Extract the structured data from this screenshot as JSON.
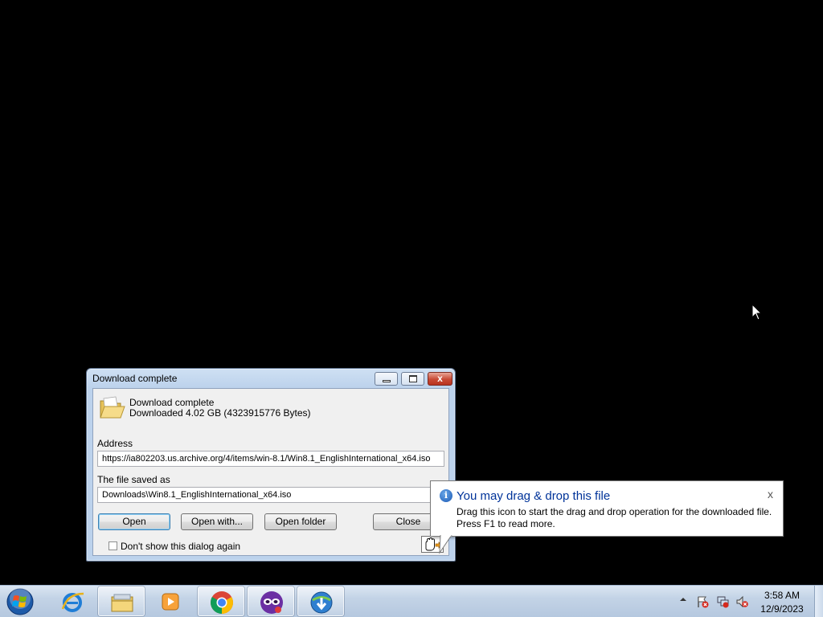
{
  "dialog": {
    "title": "Download complete",
    "status_line1": "Download complete",
    "status_line2": "Downloaded 4.02  GB (4323915776 Bytes)",
    "address_label": "Address",
    "address_value": "https://ia802203.us.archive.org/4/items/win-8.1/Win8.1_EnglishInternational_x64.iso",
    "saved_label": "The file saved as",
    "saved_value": "Downloads\\Win8.1_EnglishInternational_x64.iso",
    "buttons": {
      "open": "Open",
      "open_with": "Open with...",
      "open_folder": "Open folder",
      "close": "Close"
    },
    "checkbox_label": "Don't show this dialog again",
    "checkbox_checked": false,
    "caption_close_glyph": "x"
  },
  "balloon": {
    "title": "You may drag & drop this file",
    "line1": "Drag this icon to start the drag and drop operation for the downloaded file.",
    "line2": "Press F1 to read more.",
    "close_glyph": "x",
    "info_glyph": "i"
  },
  "taskbar": {
    "pinned": [
      {
        "name": "internet-explorer",
        "icon": "ie-icon"
      },
      {
        "name": "windows-explorer",
        "icon": "folder-icon"
      },
      {
        "name": "media-player",
        "icon": "media-player-icon"
      },
      {
        "name": "chrome",
        "icon": "chrome-icon"
      },
      {
        "name": "app-mask",
        "icon": "mask-icon"
      },
      {
        "name": "download-manager",
        "icon": "idm-icon"
      }
    ],
    "clock_time": "3:58 AM",
    "clock_date": "12/9/2023"
  },
  "colors": {
    "desktop": "#000000",
    "balloon_title": "#003399",
    "taskbar": "#c3d3e6"
  }
}
